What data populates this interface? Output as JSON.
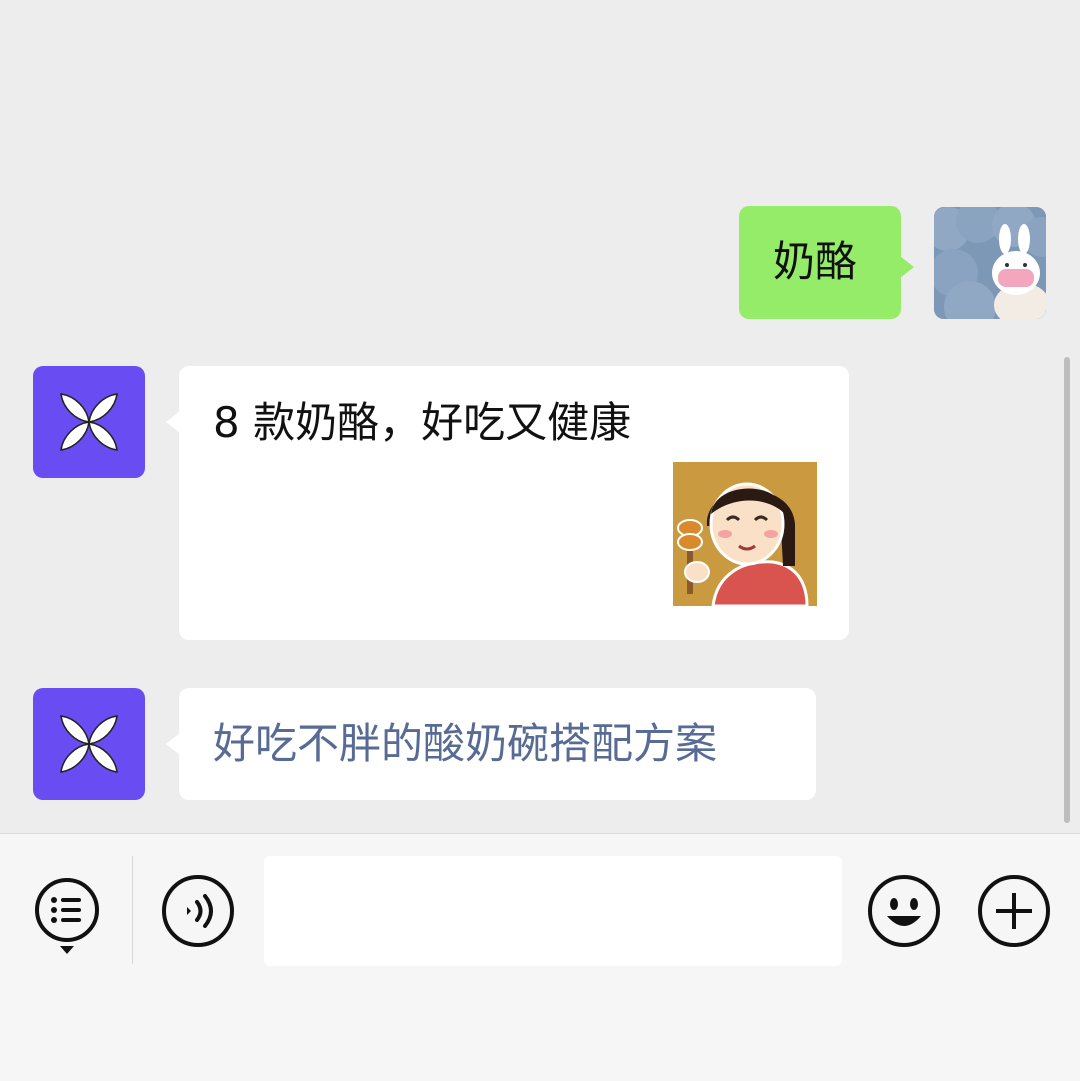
{
  "conversation": {
    "messages": [
      {
        "sender": "user",
        "type": "text",
        "text": "奶酪"
      },
      {
        "sender": "bot",
        "type": "text+sticker",
        "text": "8 款奶酪，好吃又健康",
        "sticker": "girl-eating-sticker"
      },
      {
        "sender": "bot",
        "type": "link",
        "text": "好吃不胖的酸奶碗搭配方案"
      }
    ]
  },
  "input_bar": {
    "text_value": "",
    "icons": [
      "menu-list-icon",
      "voice-icon",
      "emoji-icon",
      "add-icon"
    ]
  },
  "colors": {
    "chat_background": "#ededed",
    "user_bubble": "#95ec69",
    "bot_bubble": "#ffffff",
    "bot_avatar": "#6a4df2",
    "link_text": "#576b95",
    "input_bar_background": "#f6f6f6"
  },
  "icons": {
    "bot_avatar": "white-petal-logo-icon",
    "user_avatar": "rabbit-mask-avatar"
  }
}
